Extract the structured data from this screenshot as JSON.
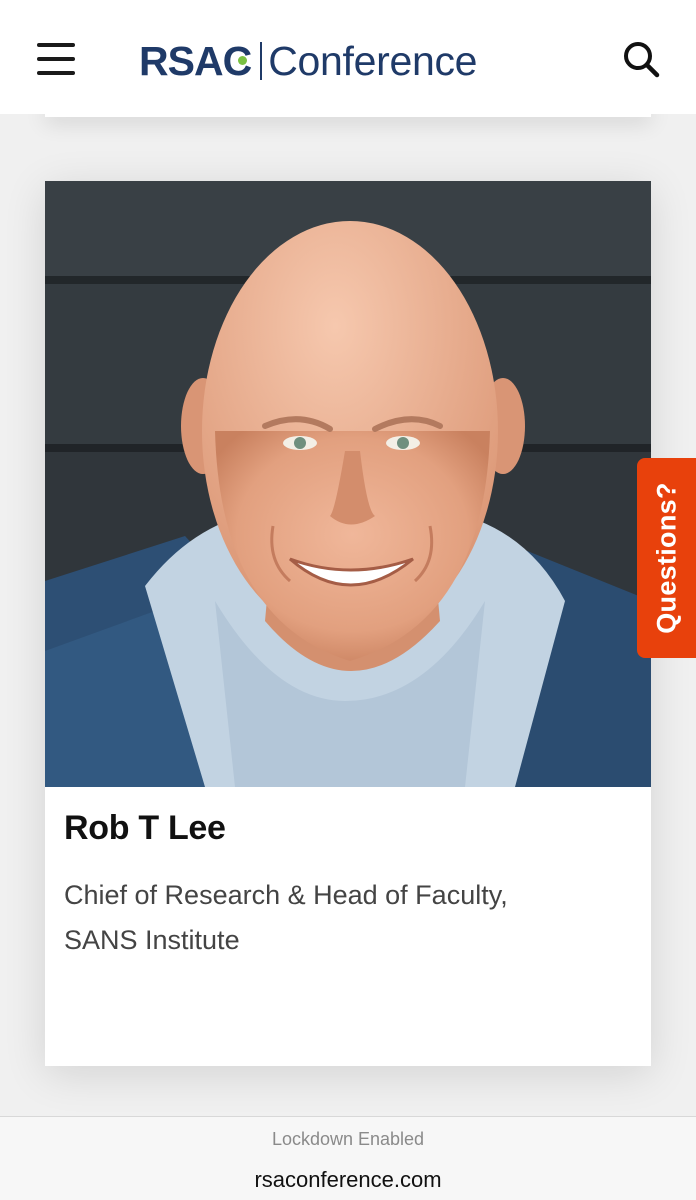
{
  "header": {
    "menu_icon": "hamburger-menu-icon",
    "logo": {
      "rsa": "RSA",
      "c": "C",
      "conference": "Conference"
    },
    "search_icon": "search-icon"
  },
  "speaker": {
    "name": "Rob T Lee",
    "title": "Chief of Research & Head of Faculty, SANS Institute"
  },
  "questions_tab": {
    "label": "Questions?"
  },
  "browser_bar": {
    "status": "Lockdown Enabled",
    "url": "rsaconference.com"
  },
  "colors": {
    "brand_navy": "#1f3a68",
    "brand_green": "#7ac142",
    "questions_orange": "#e8410c"
  }
}
